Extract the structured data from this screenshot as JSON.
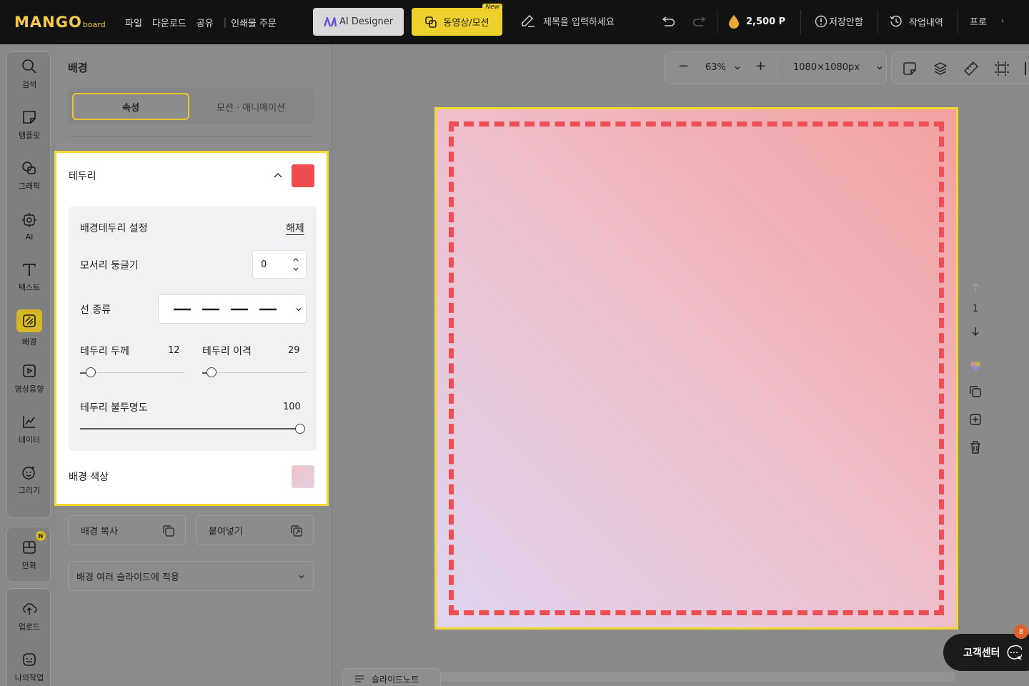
{
  "topbar": {
    "logo_main": "MANGO",
    "logo_sub": "board",
    "menu": [
      "파일",
      "다운로드",
      "공유",
      "인쇄물 주문"
    ],
    "ai_designer": "AI Designer",
    "video_motion": "동영상/모션",
    "new_badge": "New",
    "title_placeholder": "제목을 입력하세요",
    "points": "2,500 P",
    "save_status": "저장안함",
    "history": "작업내역",
    "pro": "프로"
  },
  "leftbar": {
    "items": [
      "검색",
      "템플릿",
      "그래픽",
      "AI",
      "텍스트",
      "배경",
      "영상음향",
      "데이터",
      "그리기"
    ],
    "comic": "만화",
    "comic_badge": "N",
    "upload": "업로드",
    "my_work": "나의작업"
  },
  "panel": {
    "title": "배경",
    "tabs": [
      "속성",
      "모션 · 애니메이션"
    ],
    "border_card": {
      "title": "테두리",
      "border_color": "#ee4c50",
      "setting_label": "배경테두리 설정",
      "release_link": "해제",
      "corner_label": "모서리 둥글기",
      "corner_value": "0",
      "line_type_label": "선 종류",
      "thickness_label": "테두리 두께",
      "thickness_value": "12",
      "offset_label": "테두리 이격",
      "offset_value": "29",
      "opacity_label": "테두리 불투명도",
      "opacity_value": "100",
      "bg_color_label": "배경 색상"
    },
    "copy_bg": "배경 복사",
    "paste": "붙여넣기",
    "apply_multi": "배경 여러 슬라이드에 적용"
  },
  "workspace": {
    "zoom": "63%",
    "size": "1080×1080px",
    "page_number": "1",
    "help": "고객센터",
    "help_badge": "8",
    "slide_note": "슬라이드노트"
  },
  "colors": {
    "accent_yellow": "#f2d92f",
    "border_red": "#ee4f55"
  }
}
